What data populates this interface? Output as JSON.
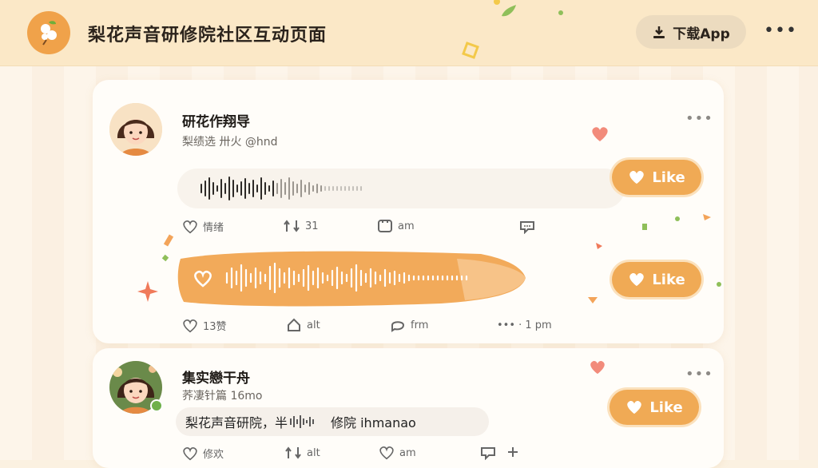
{
  "header": {
    "title": "梨花声音研修院社区互动页面",
    "download_label": "下载App",
    "more": "•••"
  },
  "posts": [
    {
      "username": "研花作翔导",
      "subtitle": "梨绩选  卅火 @hnd",
      "more": "•••",
      "audio1_label": "voice-message",
      "like_label": "Like",
      "actions1": {
        "like": "情绪",
        "repost": "31",
        "comment": "am"
      },
      "like_label2": "Like",
      "actions2": {
        "like": "13赞",
        "share": "alt",
        "comment": "frm",
        "time": "••• · 1 pm"
      }
    },
    {
      "username": "集实戀干舟",
      "subtitle": "荞凄针篇 16mo",
      "more": "•••",
      "reply_text": "梨花声音研院，半",
      "reply_tail": "修院 ihmanao",
      "like_label": "Like",
      "actions": {
        "like": "修欢",
        "repost": "alt",
        "comment": "am"
      }
    }
  ],
  "colors": {
    "accent": "#f0aa55",
    "topbar": "#fbe8c7",
    "background": "#fbf1e1"
  }
}
